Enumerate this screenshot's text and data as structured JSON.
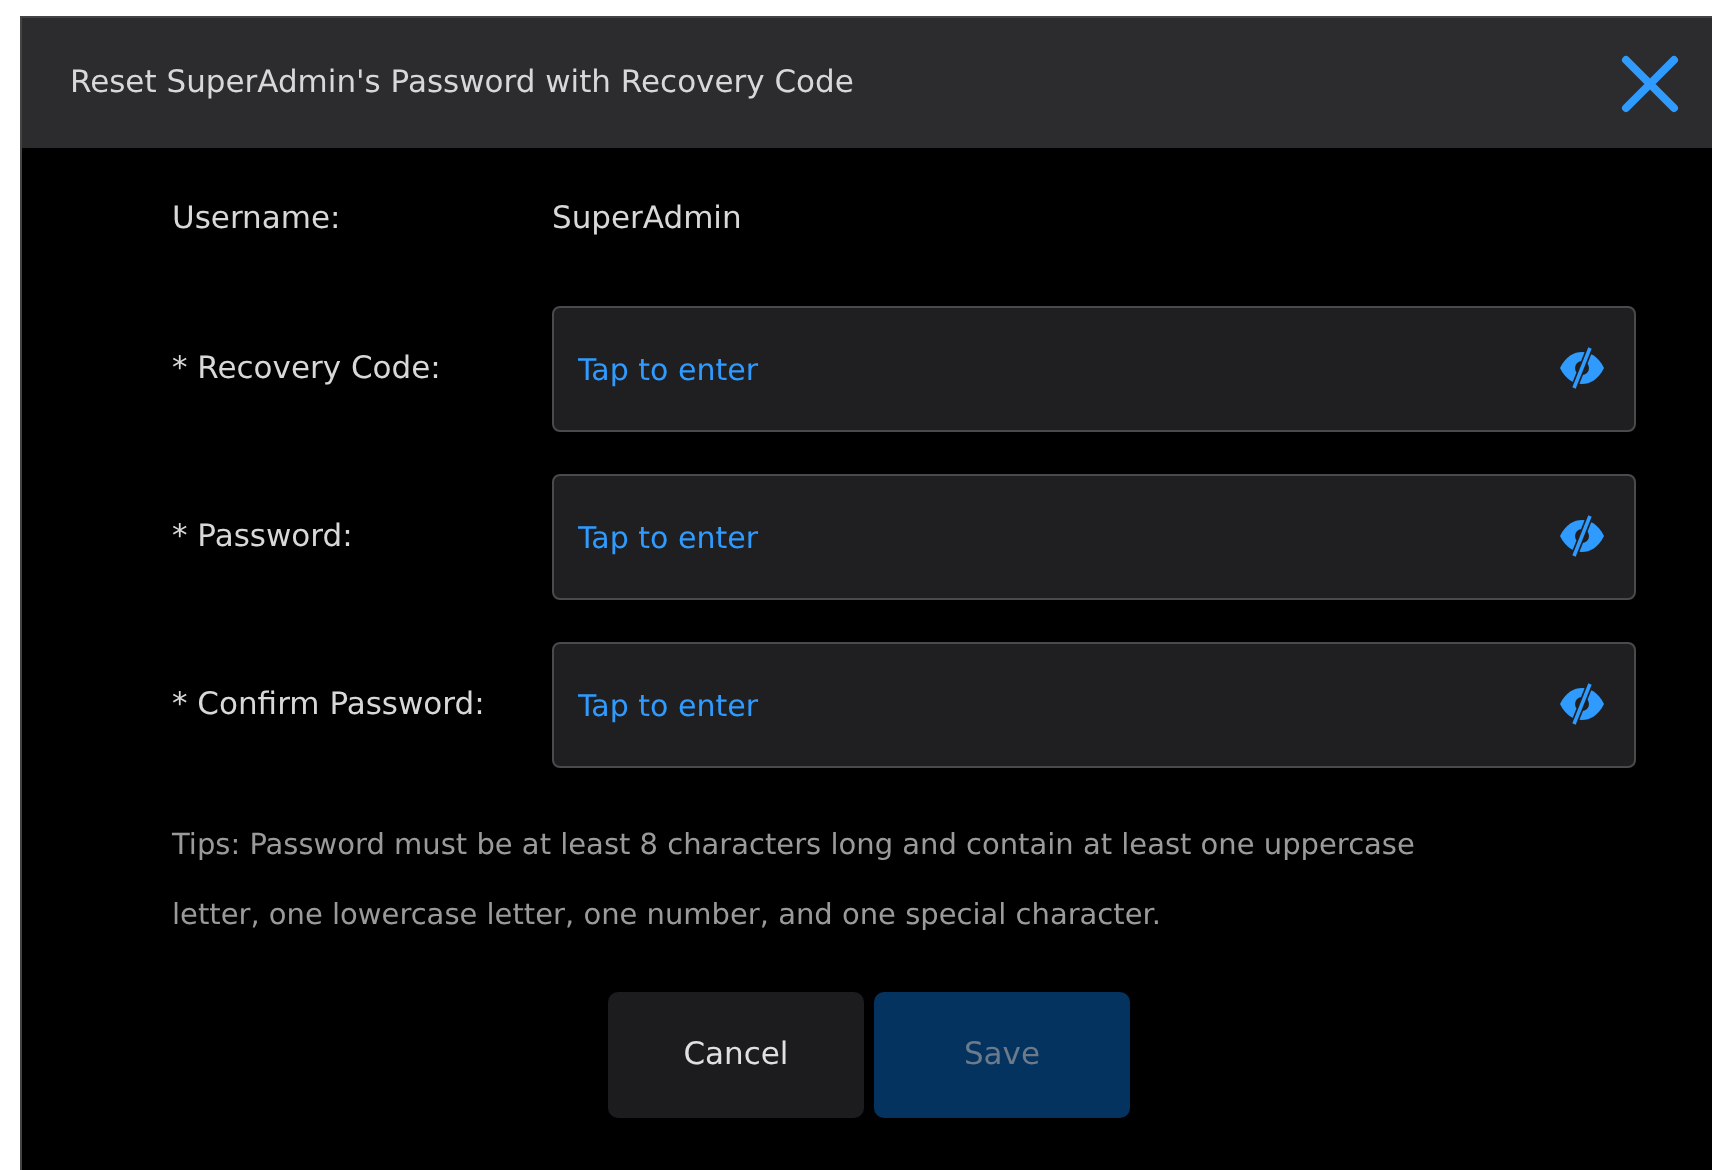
{
  "dialog": {
    "title": "Reset SuperAdmin's Password with Recovery Code"
  },
  "username": {
    "label": "Username:",
    "value": "SuperAdmin"
  },
  "fields": [
    {
      "label": "* Recovery Code:",
      "placeholder": "Tap to enter",
      "masked": true
    },
    {
      "label": "* Password:",
      "placeholder": "Tap to enter",
      "masked": true
    },
    {
      "label": "* Confirm Password:",
      "placeholder": "Tap to enter",
      "masked": true
    }
  ],
  "tips": "Tips: Password must be at least 8 characters long and contain at least one uppercase letter, one lowercase letter, one number, and one special character.",
  "buttons": [
    {
      "label": "Cancel",
      "kind": "secondary",
      "disabled": false
    },
    {
      "label": "Save",
      "kind": "primary",
      "disabled": true
    }
  ]
}
